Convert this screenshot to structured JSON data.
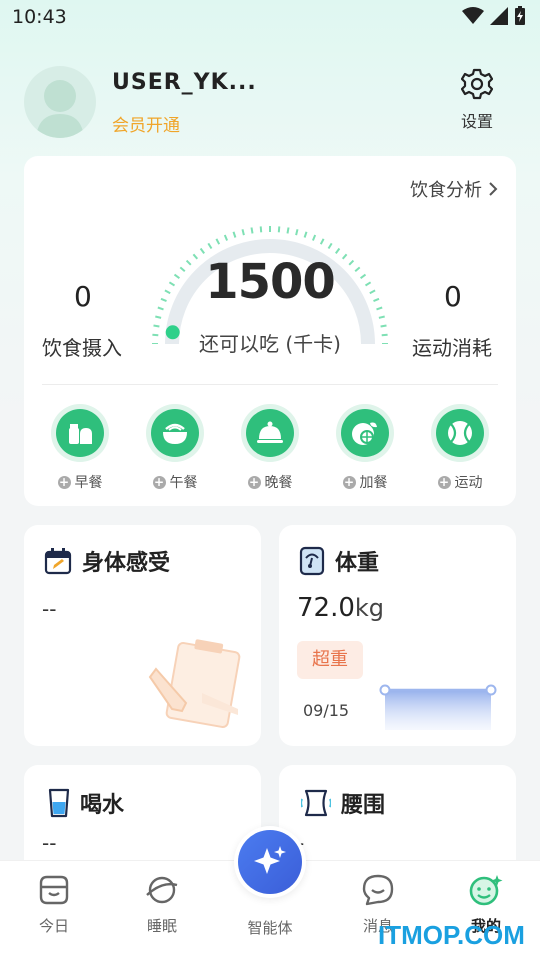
{
  "status": {
    "time": "10:43"
  },
  "profile": {
    "username": "USER_YK...",
    "member_link": "会员开通",
    "settings_label": "设置"
  },
  "diet": {
    "analysis_label": "饮食分析",
    "remaining": "1500",
    "remaining_caption": "还可以吃 (千卡)",
    "intake_value": "0",
    "intake_label": "饮食摄入",
    "burn_value": "0",
    "burn_label": "运动消耗",
    "remaining_fraction": 0.0,
    "meals": [
      {
        "label": "早餐",
        "icon": "breakfast-icon"
      },
      {
        "label": "午餐",
        "icon": "lunch-icon"
      },
      {
        "label": "晚餐",
        "icon": "dinner-icon"
      },
      {
        "label": "加餐",
        "icon": "snack-icon"
      },
      {
        "label": "运动",
        "icon": "exercise-icon"
      }
    ]
  },
  "body_feel": {
    "title": "身体感受",
    "value": "--"
  },
  "weight": {
    "title": "体重",
    "value": "72.0",
    "unit": "kg",
    "status": "超重",
    "date": "09/15"
  },
  "water": {
    "title": "喝水",
    "value": "--"
  },
  "waist": {
    "title": "腰围",
    "value": "-"
  },
  "nav": {
    "items": [
      {
        "label": "今日",
        "icon": "today-icon"
      },
      {
        "label": "睡眠",
        "icon": "sleep-icon"
      },
      {
        "label": "智能体",
        "icon": "sparkle-icon"
      },
      {
        "label": "消息",
        "icon": "message-icon"
      },
      {
        "label": "我的",
        "icon": "profile-icon"
      }
    ]
  },
  "watermark": "ITMOP.COM",
  "colors": {
    "accent_green": "#2fbf7c",
    "member_orange": "#f0a52a",
    "overweight_red": "#e8744c",
    "ai_blue": "#3b5ed8"
  }
}
